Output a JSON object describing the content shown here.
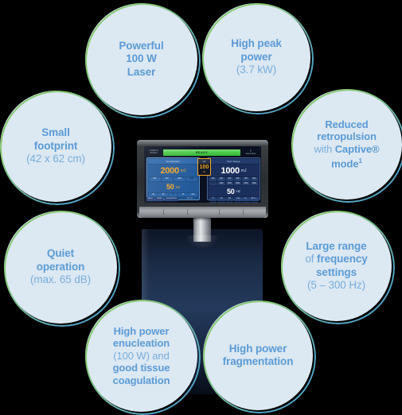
{
  "theme": {
    "background": "#000000",
    "bubble_fill": "#dce8f2",
    "bubble_text": "#5b9bd5",
    "ring_green": "#7cc46a",
    "ring_blue": "#4e9fc4",
    "accent_orange": "#f5a623",
    "ready_green": "#4cc94c"
  },
  "bubbles": [
    {
      "id": "powerful",
      "line1": "Powerful",
      "line2": "100 W",
      "line3": "Laser"
    },
    {
      "id": "peak",
      "line1": "High peak",
      "line2": "power",
      "line3": "(3.7 kW)"
    },
    {
      "id": "retropulsion",
      "line1": "Reduced",
      "line2": "retropulsion",
      "line3_light": "with ",
      "line3_bold": "Captive®",
      "line4": "mode",
      "line4_sup": "1"
    },
    {
      "id": "largerange",
      "line1": "Large range",
      "line2_light": "of ",
      "line2_bold": "frequency",
      "line3": "settings",
      "line4": "(5 – 300 Hz)"
    },
    {
      "id": "fragmentation",
      "line1": "High power",
      "line2": "fragmentation"
    },
    {
      "id": "enucleation",
      "line1": "High power",
      "line2": "enucleation",
      "line3": "(100 W) and",
      "line4": "good tissue",
      "line5": "coagulation"
    },
    {
      "id": "quiet",
      "line1": "Quiet",
      "line2": "operation",
      "line3": "(max. 65 dB)"
    },
    {
      "id": "footprint",
      "line1": "Small",
      "line2": "footprint",
      "line3": "(42 x 62 cm)"
    }
  ],
  "device": {
    "screen": {
      "logo_line1": "LUMENIS",
      "logo_line2": "MOSES",
      "status": "READY",
      "user_glyph": "♀",
      "user_label": "Select Mode",
      "power_badge": {
        "top_label": "kW",
        "value": "100",
        "unit": "W"
      },
      "left_panel": {
        "title": "Enucleation",
        "energy_value": "2000",
        "energy_unit": "mJ",
        "energy_presets": [
          "500",
          "800",
          "1200",
          "2000"
        ],
        "energy_active_index": 3,
        "frequency_value": "50",
        "frequency_unit": "Hz",
        "frequency_presets": [
          "20",
          "30",
          "50",
          "70",
          "100"
        ],
        "frequency_active_index": 2
      },
      "right_panel": {
        "title": "Soft Tissue",
        "energy_value": "1000",
        "energy_unit": "mJ",
        "energy_presets_row1": [
          "200",
          "300",
          "400",
          "500",
          "600",
          "800"
        ],
        "energy_presets_row2": [
          "1000",
          "1200",
          "1500",
          "2000",
          "2500",
          "3000"
        ],
        "energy_active_row": 2,
        "energy_active_index": 0,
        "frequency_value": "50",
        "frequency_unit": "Hz",
        "frequency_presets_row1": [
          "5",
          "10",
          "15",
          "20",
          "25",
          "30"
        ],
        "frequency_presets_row2": [
          "40",
          "50",
          "60",
          "80",
          "100",
          "120"
        ],
        "frequency_active_row": 2,
        "frequency_active_index": 1
      },
      "bottom_bar": {
        "item1": "Menu",
        "item2": "Mode",
        "item3": "Accessories",
        "fiber_icon": "⑀",
        "fiber": "365 µm",
        "item4": "CO₂",
        "item5": "C₂",
        "item6": "30°C…"
      }
    }
  }
}
